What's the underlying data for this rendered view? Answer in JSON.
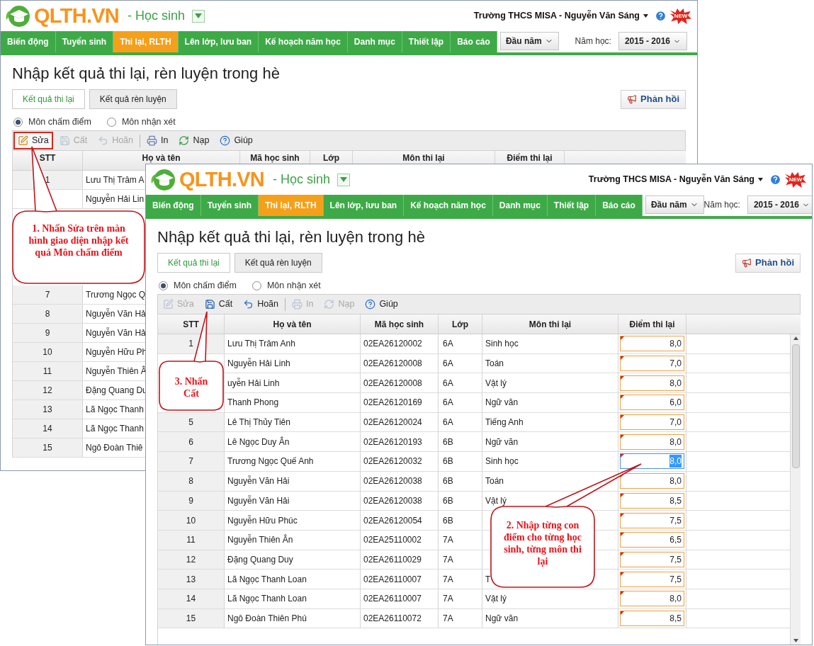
{
  "back_window": {
    "header": {
      "app_name": "QLTH.VN",
      "role": "- Học sinh",
      "user": "Trường THCS MISA - Nguyễn Văn Sáng",
      "badge": "NEW"
    },
    "nav": [
      {
        "label": "Biến động",
        "selected": false
      },
      {
        "label": "Tuyển sinh",
        "selected": false
      },
      {
        "label": "Thi lại, RLTH",
        "selected": true
      },
      {
        "label": "Lên lớp, lưu ban",
        "selected": false
      },
      {
        "label": "Kế hoạch năm học",
        "selected": false
      },
      {
        "label": "Danh mục",
        "selected": false
      },
      {
        "label": "Thiết lập",
        "selected": false
      },
      {
        "label": "Báo cáo",
        "selected": false
      }
    ],
    "period": "Đầu năm",
    "year_label": "Năm học:",
    "year": "2015 - 2016",
    "title": "Nhập kết quả thi lại, rèn luyện trong hè",
    "tabs": [
      {
        "label": "Kết quả thi lại",
        "selected": true
      },
      {
        "label": "Kết quả rèn luyện",
        "selected": false
      }
    ],
    "feedback_button": "Phản hồi",
    "radios": [
      {
        "label": "Môn chấm điểm",
        "selected": true
      },
      {
        "label": "Môn nhận xét",
        "selected": false
      }
    ],
    "toolbar": [
      {
        "kind": "edit",
        "label": "Sửa",
        "disabled": false,
        "highlighted": true
      },
      {
        "kind": "save",
        "label": "Cất",
        "disabled": true,
        "highlighted": false
      },
      {
        "kind": "undo",
        "label": "Hoãn",
        "disabled": true,
        "highlighted": false
      },
      {
        "kind": "print",
        "label": "In",
        "disabled": false,
        "highlighted": false
      },
      {
        "kind": "reload",
        "label": "Nạp",
        "disabled": false,
        "highlighted": false
      },
      {
        "kind": "help",
        "label": "Giúp",
        "disabled": false,
        "highlighted": false
      }
    ],
    "table": {
      "columns": [
        "STT",
        "Họ và tên",
        "Mã học sinh",
        "Lớp",
        "Môn thi lại",
        "Điểm thi lại"
      ],
      "rows": [
        {
          "stt": "1",
          "name": "Lưu Thị Trâm A"
        },
        {
          "name": "Nguyễn Hải Lin"
        },
        {
          "stt": "7",
          "name": "Trương Ngọc Q"
        },
        {
          "stt": "8",
          "name": "Nguyễn Văn Hả"
        },
        {
          "stt": "9",
          "name": "Nguyễn Văn Hả"
        },
        {
          "stt": "10",
          "name": "Nguyễn Hữu Ph"
        },
        {
          "stt": "11",
          "name": "Nguyễn Thiên Â"
        },
        {
          "stt": "12",
          "name": "Đặng Quang Du"
        },
        {
          "stt": "13",
          "name": "Lã Ngọc Thanh"
        },
        {
          "stt": "14",
          "name": "Lã Ngọc Thanh"
        },
        {
          "stt": "15",
          "name": "Ngô Đoàn Thiê"
        }
      ]
    },
    "callout": "1. Nhấn Sửa trên màn hình giao diện nhập kết quả Môn chấm điểm"
  },
  "front_window": {
    "header": {
      "app_name": "QLTH.VN",
      "role": "- Học sinh",
      "user": "Trường THCS MISA - Nguyễn Văn Sáng",
      "badge": "NEW"
    },
    "nav": [
      {
        "label": "Biến động",
        "selected": false
      },
      {
        "label": "Tuyển sinh",
        "selected": false
      },
      {
        "label": "Thi lại, RLTH",
        "selected": true
      },
      {
        "label": "Lên lớp, lưu ban",
        "selected": false
      },
      {
        "label": "Kế hoạch năm học",
        "selected": false
      },
      {
        "label": "Danh mục",
        "selected": false
      },
      {
        "label": "Thiết lập",
        "selected": false
      },
      {
        "label": "Báo cáo",
        "selected": false
      }
    ],
    "period": "Đầu năm",
    "year_label": "Năm học:",
    "year": "2015 - 2016",
    "title": "Nhập kết quả thi lại, rèn luyện trong hè",
    "tabs": [
      {
        "label": "Kết quả thi lại",
        "selected": true
      },
      {
        "label": "Kết quả rèn luyện",
        "selected": false
      }
    ],
    "feedback_button": "Phản hồi",
    "radios": [
      {
        "label": "Môn chấm điểm",
        "selected": true
      },
      {
        "label": "Môn nhận xét",
        "selected": false
      }
    ],
    "toolbar": [
      {
        "kind": "edit",
        "label": "Sửa",
        "disabled": true,
        "highlighted": false
      },
      {
        "kind": "save",
        "label": "Cất",
        "disabled": false,
        "highlighted": false
      },
      {
        "kind": "undo",
        "label": "Hoãn",
        "disabled": false,
        "highlighted": false
      },
      {
        "kind": "print",
        "label": "In",
        "disabled": true,
        "highlighted": false
      },
      {
        "kind": "reload",
        "label": "Nạp",
        "disabled": true,
        "highlighted": false
      },
      {
        "kind": "help",
        "label": "Giúp",
        "disabled": false,
        "highlighted": false
      }
    ],
    "table": {
      "columns": [
        "STT",
        "Họ và tên",
        "Mã học sinh",
        "Lớp",
        "Môn thi lại",
        "Điểm thi lại"
      ],
      "rows": [
        {
          "stt": "1",
          "name": "Lưu Thị Trâm Anh",
          "student_code": "02EA26120002",
          "class": "6A",
          "subject": "Sinh học",
          "score": {
            "value": "8,0",
            "selected": false,
            "changed": true
          }
        },
        {
          "name": "Nguyễn Hải Linh",
          "student_code": "02EA26120008",
          "class": "6A",
          "subject": "Toán",
          "score": {
            "value": "7,0",
            "selected": false,
            "changed": true
          }
        },
        {
          "name": "uyễn Hải Linh",
          "student_code": "02EA26120008",
          "class": "6A",
          "subject": "Vật lý",
          "score": {
            "value": "8,0",
            "selected": false,
            "changed": true
          }
        },
        {
          "name": "Thanh Phong",
          "student_code": "02EA26120169",
          "class": "6A",
          "subject": "Ngữ văn",
          "score": {
            "value": "6,0",
            "selected": false,
            "changed": true
          }
        },
        {
          "stt": "5",
          "name": "Lê Thị Thủy Tiên",
          "student_code": "02EA26120024",
          "class": "6A",
          "subject": "Tiếng Anh",
          "score": {
            "value": "7,0",
            "selected": false,
            "changed": true
          }
        },
        {
          "stt": "6",
          "name": "Lê Ngọc Duy Ân",
          "student_code": "02EA26120193",
          "class": "6B",
          "subject": "Ngữ văn",
          "score": {
            "value": "8,0",
            "selected": false,
            "changed": true
          }
        },
        {
          "stt": "7",
          "name": "Trương Ngọc Quế Anh",
          "student_code": "02EA26120032",
          "class": "6B",
          "subject": "Sinh học",
          "score": {
            "value": "8,0",
            "selected": true,
            "changed": true
          }
        },
        {
          "stt": "8",
          "name": "Nguyễn Văn Hải",
          "student_code": "02EA26120038",
          "class": "6B",
          "subject": "Toán",
          "score": {
            "value": "8,0",
            "selected": false,
            "changed": true
          }
        },
        {
          "stt": "9",
          "name": "Nguyễn Văn Hải",
          "student_code": "02EA26120038",
          "class": "6B",
          "subject": "Vật lý",
          "score": {
            "value": "8,5",
            "selected": false,
            "changed": true
          }
        },
        {
          "stt": "10",
          "name": "Nguyễn Hữu Phúc",
          "student_code": "02EA26120054",
          "class": "6B",
          "score": {
            "value": "7,5",
            "selected": false,
            "changed": true
          }
        },
        {
          "stt": "11",
          "name": "Nguyễn Thiên Ân",
          "student_code": "02EA25110002",
          "class": "7A",
          "score": {
            "value": "6,5",
            "selected": false,
            "changed": true
          }
        },
        {
          "stt": "12",
          "name": "Đặng Quang Duy",
          "student_code": "02EA26110029",
          "class": "7A",
          "score": {
            "value": "7,5",
            "selected": false,
            "changed": true
          }
        },
        {
          "stt": "13",
          "name": "Lã Ngọc Thanh Loan",
          "student_code": "02EA26110007",
          "class": "7A",
          "subject": "T",
          "score": {
            "value": "7,5",
            "selected": false,
            "changed": true
          }
        },
        {
          "stt": "14",
          "name": "Lã Ngọc Thanh Loan",
          "student_code": "02EA26110007",
          "class": "7A",
          "subject": "Vật lý",
          "score": {
            "value": "8,0",
            "selected": false,
            "changed": true
          }
        },
        {
          "stt": "15",
          "name": "Ngô Đoàn Thiên Phú",
          "student_code": "02EA26110072",
          "class": "7A",
          "subject": "Ngữ văn",
          "score": {
            "value": "8,5",
            "selected": false,
            "changed": true
          }
        }
      ]
    },
    "callouts": [
      "3. Nhấn Cất",
      "2. Nhập từng con điểm cho từng học sinh, từng môn thi lại"
    ]
  }
}
